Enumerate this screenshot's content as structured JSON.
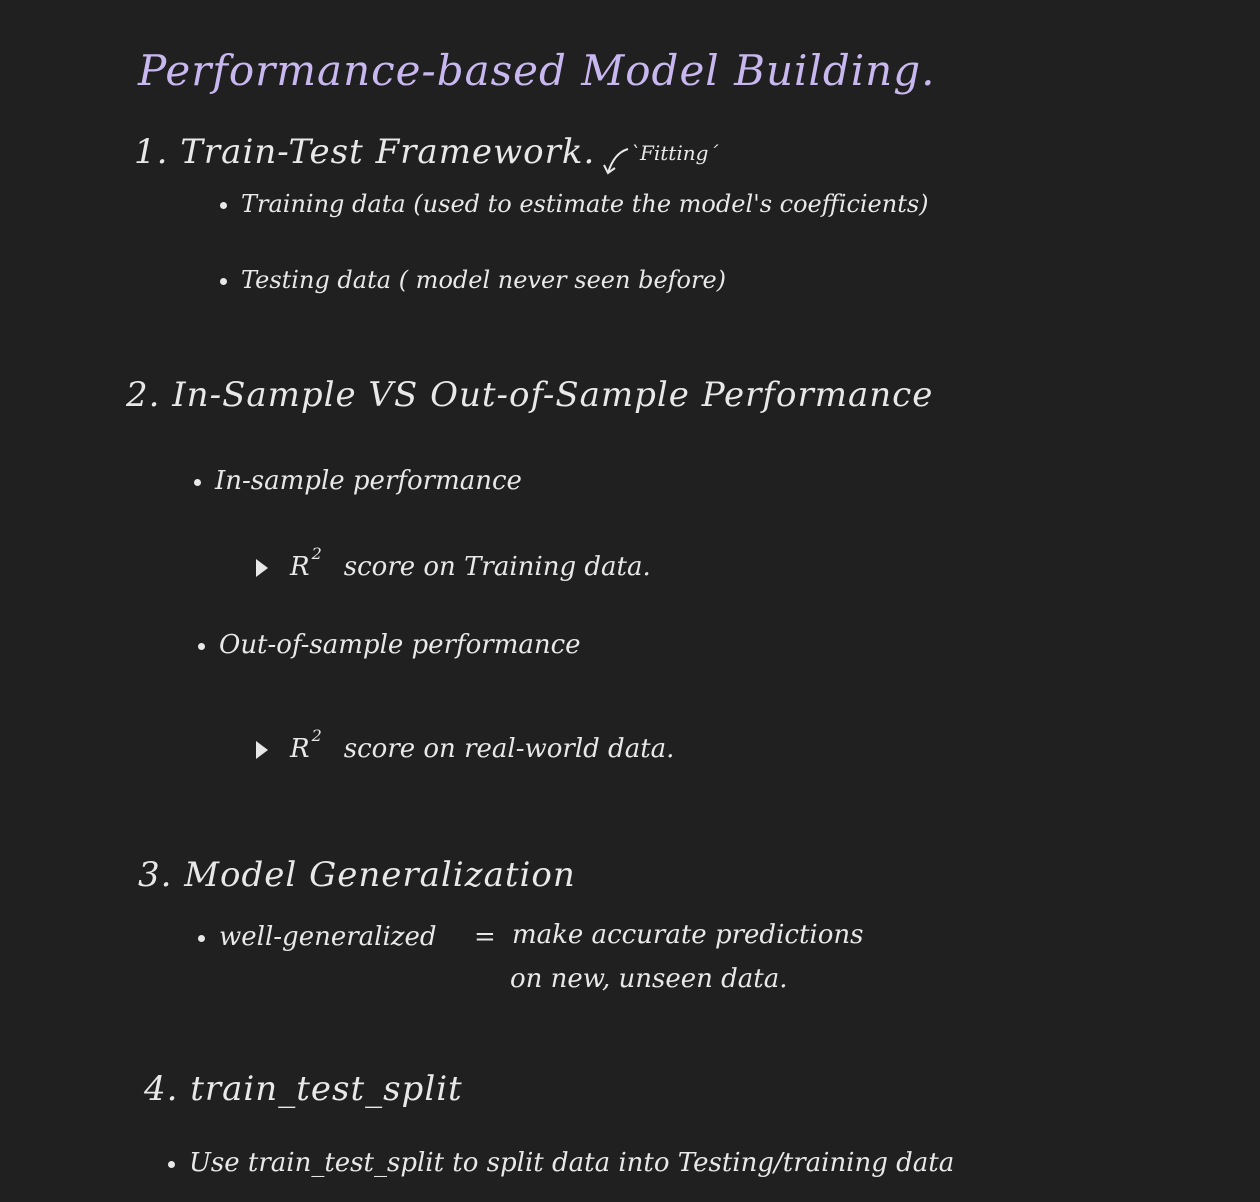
{
  "title": "Performance-based Model Building.",
  "sections": [
    {
      "heading": "1. Train-Test Framework.",
      "annotation": "`Fitting´",
      "bullets": [
        "Training data (used to estimate the model's coefficients)",
        "Testing data ( model never seen before)"
      ]
    },
    {
      "heading": "2. In-Sample VS Out-of-Sample Performance",
      "bullets": [
        {
          "label": "In-sample performance",
          "detail": {
            "symbol": "R",
            "exponent": "2",
            "text": "score on Training data."
          }
        },
        {
          "label": "Out-of-sample performance",
          "detail": {
            "symbol": "R",
            "exponent": "2",
            "text": "score on real-world data."
          }
        }
      ]
    },
    {
      "heading": "3. Model Generalization",
      "bullets": [
        {
          "term": "well-generalized",
          "equals": "=",
          "line1": "make accurate predictions",
          "line2": "on new, unseen data."
        }
      ]
    },
    {
      "heading": "4. train_test_split",
      "bullets": [
        "Use train_test_split to split data into Testing/training data"
      ]
    }
  ],
  "colors": {
    "background": "#202020",
    "ink": "#e8e8e8",
    "title_ink": "#c9b8f0"
  }
}
